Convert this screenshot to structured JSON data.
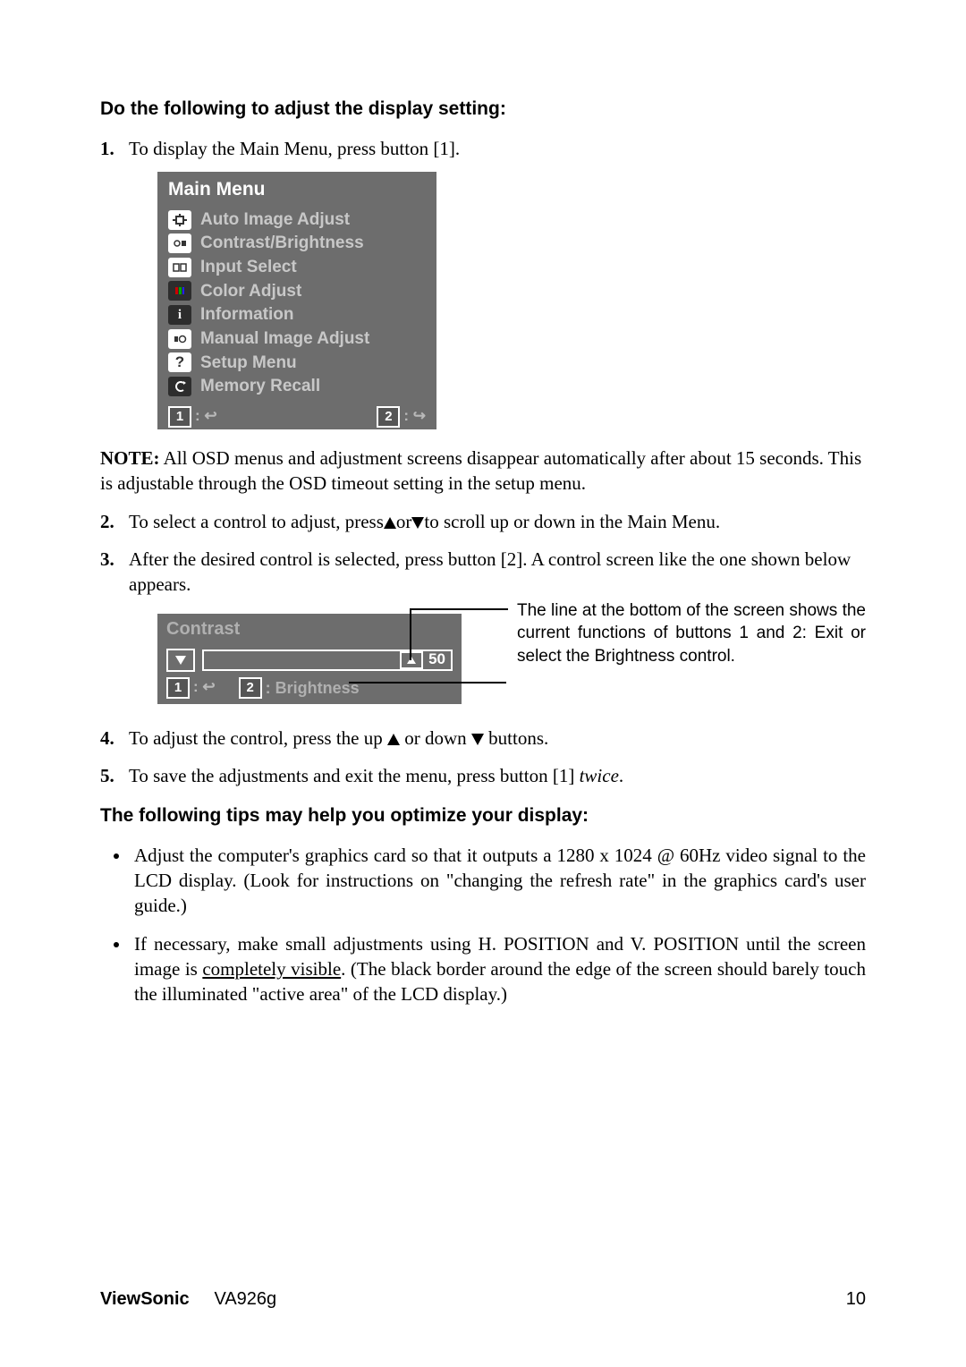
{
  "heading1": "Do the following to adjust the display setting:",
  "step1": "To display the Main Menu, press button [1].",
  "osd": {
    "title": "Main Menu",
    "items": [
      "Auto Image Adjust",
      "Contrast/Brightness",
      "Input Select",
      "Color Adjust",
      "Information",
      "Manual Image Adjust",
      "Setup Menu",
      "Memory Recall"
    ],
    "key1": "1",
    "key2": "2"
  },
  "note_label": "NOTE:",
  "note_text": " All OSD menus and adjustment screens disappear automatically after about 15 seconds. This is adjustable through the OSD timeout setting in the setup menu.",
  "step2_a": "To select a control to adjust, press",
  "step2_b": "or",
  "step2_c": "to scroll up or down in the Main Menu.",
  "step3": "After the desired control is selected, press button [2]. A control screen like the one shown below appears.",
  "contrast": {
    "title": "Contrast",
    "value": "50",
    "key1": "1",
    "key2": "2",
    "brightness_label": ": Brightness"
  },
  "annotation": "The line at the bottom of the screen shows the current functions of buttons 1 and 2: Exit or select the Brightness control.",
  "step4_a": "To adjust the control, press the up ",
  "step4_b": " or down ",
  "step4_c": " buttons.",
  "step5_a": "To save the adjustments and exit the menu, press button [1] ",
  "step5_b": "twice",
  "step5_c": ".",
  "heading2": "The following tips may help you optimize your display:",
  "tip1": "Adjust the computer's graphics card so that it outputs a 1280 x 1024 @ 60Hz video signal to the LCD display. (Look for instructions on \"changing the refresh rate\" in the graphics card's user guide.)",
  "tip2_a": "If necessary, make small adjustments using H. POSITION and V. POSITION until the screen image is ",
  "tip2_underline": "completely visible",
  "tip2_b": ". (The black border around the edge of the screen should barely touch the illuminated \"active area\" of the LCD display.)",
  "footer": {
    "brand": "ViewSonic",
    "model": "VA926g",
    "pagenum": "10"
  }
}
